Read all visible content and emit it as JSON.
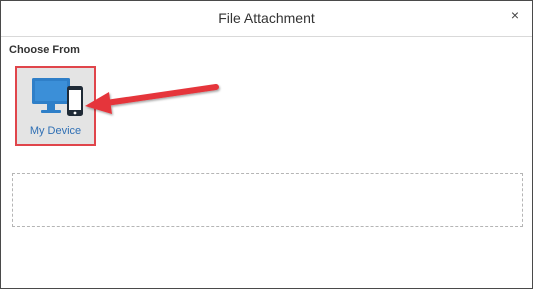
{
  "dialog": {
    "title": "File Attachment",
    "close_label": "×"
  },
  "section": {
    "label": "Choose From"
  },
  "options": [
    {
      "label": "My Device",
      "icon": "monitor-phone-icon"
    }
  ],
  "colors": {
    "highlight_border": "#e0454b",
    "tile_bg": "#e4e4e4",
    "icon_blue": "#2f7fc8",
    "label_blue": "#2f6fb4",
    "arrow_red": "#e5343b"
  }
}
